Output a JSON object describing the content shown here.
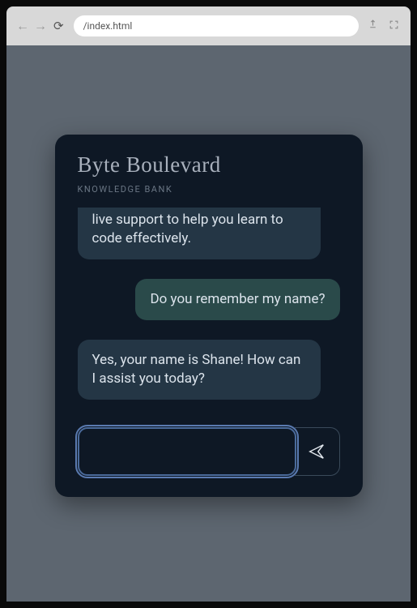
{
  "browser": {
    "url": "/index.html"
  },
  "app": {
    "title": "Byte Boulevard",
    "subtitle": "KNOWLEDGE BANK"
  },
  "messages": [
    {
      "role": "bot",
      "text": "live support to help you learn to code effectively.",
      "clipped": true
    },
    {
      "role": "user",
      "text": "Do you remember my name?"
    },
    {
      "role": "bot",
      "text": "Yes, your name is Shane! How can I assist you today?"
    }
  ],
  "input": {
    "value": "",
    "placeholder": ""
  }
}
